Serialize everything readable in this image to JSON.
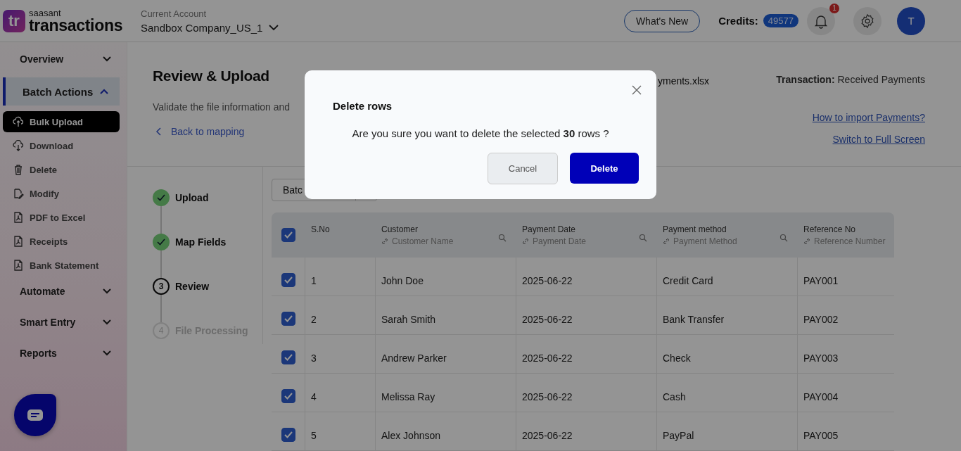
{
  "header": {
    "logo": {
      "mark": "tr",
      "brand_small": "saasant",
      "brand": "transactions"
    },
    "account": {
      "label": "Current Account",
      "value": "Sandbox Company_US_1"
    },
    "whats_new": "What's New",
    "credits": {
      "label": "Credits:",
      "value": "49577"
    },
    "notifications": {
      "count": "1"
    },
    "avatar": "T"
  },
  "sidebar": [
    {
      "label": "Overview",
      "expanded": false,
      "selected": false
    },
    {
      "label": "Batch Actions",
      "expanded": true,
      "selected": true,
      "items": [
        {
          "label": "Bulk Upload",
          "kind": "upload",
          "selected": true
        },
        {
          "label": "Download",
          "kind": "download",
          "selected": false
        },
        {
          "label": "Delete",
          "kind": "trash",
          "selected": false
        },
        {
          "label": "Modify",
          "kind": "modify",
          "selected": false
        },
        {
          "label": "PDF to Excel",
          "kind": "pdf",
          "selected": false
        },
        {
          "label": "Receipts",
          "kind": "pdf",
          "selected": false
        },
        {
          "label": "Bank Statement",
          "kind": "pdf",
          "selected": false
        }
      ]
    },
    {
      "label": "Automate",
      "expanded": false,
      "selected": false
    },
    {
      "label": "Smart Entry",
      "expanded": false,
      "selected": false
    },
    {
      "label": "Reports",
      "expanded": false,
      "selected": false
    }
  ],
  "page": {
    "title": "Review & Upload",
    "subtitle": "Validate the file information and",
    "back_link": "Back to mapping",
    "file_name": "yments.xlsx",
    "transaction": {
      "label": "Transaction:",
      "value": "Received Payments"
    },
    "links": [
      "How to import Payments?",
      "Switch to Full Screen"
    ]
  },
  "steps": [
    {
      "label": "Upload",
      "completed": true,
      "disabled": false
    },
    {
      "label": "Map Fields",
      "completed": true,
      "disabled": false
    },
    {
      "number": "3",
      "label": "Review",
      "completed": false,
      "disabled": false
    },
    {
      "number": "4",
      "label": "File Processing",
      "completed": false,
      "disabled": true
    }
  ],
  "table": {
    "batch_button": "Batc",
    "all_checked": true,
    "columns": [
      {
        "title": "S.No"
      },
      {
        "title": "Customer",
        "field": "Customer Name"
      },
      {
        "title": "Payment Date",
        "field": "Payment Date"
      },
      {
        "title": "Payment method",
        "field": "Payment Method"
      },
      {
        "title": "Reference No",
        "field": "Reference Number"
      }
    ],
    "rows": [
      {
        "checked": true,
        "cells": [
          "1",
          "John Doe",
          "2025-06-22",
          "Credit Card",
          "PAY001"
        ]
      },
      {
        "checked": true,
        "cells": [
          "2",
          "Sarah Smith",
          "2025-06-22",
          "Bank Transfer",
          "PAY002"
        ]
      },
      {
        "checked": true,
        "cells": [
          "3",
          "Andrew Parker",
          "2025-06-22",
          "Check",
          "PAY003"
        ]
      },
      {
        "checked": true,
        "cells": [
          "4",
          "Melissa Ray",
          "2025-06-22",
          "Cash",
          "PAY004"
        ]
      },
      {
        "checked": true,
        "cells": [
          "5",
          "Alex Johnson",
          "2025-06-22",
          "PayPal",
          "PAY005"
        ]
      }
    ]
  },
  "dialog": {
    "title": "Delete rows",
    "message": "Are you sure you want to delete the selected **30** rows ?",
    "cancel": "Cancel",
    "confirm": "Delete"
  }
}
